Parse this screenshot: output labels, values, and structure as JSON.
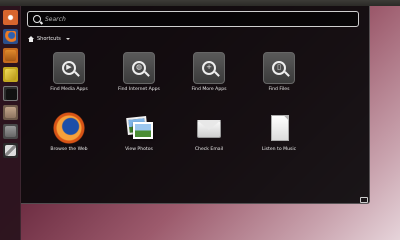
{
  "search": {
    "placeholder": "Search"
  },
  "section": {
    "title": "Shortcuts"
  },
  "lenses": [
    {
      "label": "Find Media Apps",
      "icon": "media-lens-icon"
    },
    {
      "label": "Find Internet Apps",
      "icon": "internet-lens-icon"
    },
    {
      "label": "Find More Apps",
      "icon": "more-apps-lens-icon"
    },
    {
      "label": "Find Files",
      "icon": "files-lens-icon"
    }
  ],
  "shortcuts": [
    {
      "label": "Browse the Web",
      "icon": "firefox-icon"
    },
    {
      "label": "View Photos",
      "icon": "photos-icon"
    },
    {
      "label": "Check Email",
      "icon": "mail-icon"
    },
    {
      "label": "Listen to Music",
      "icon": "music-icon"
    }
  ],
  "launcher": {
    "items": [
      "bfb-icon",
      "firefox-icon",
      "home-folder-icon",
      "text-editor-icon",
      "terminal-icon",
      "files-icon",
      "document-icon",
      "tools-icon"
    ]
  }
}
